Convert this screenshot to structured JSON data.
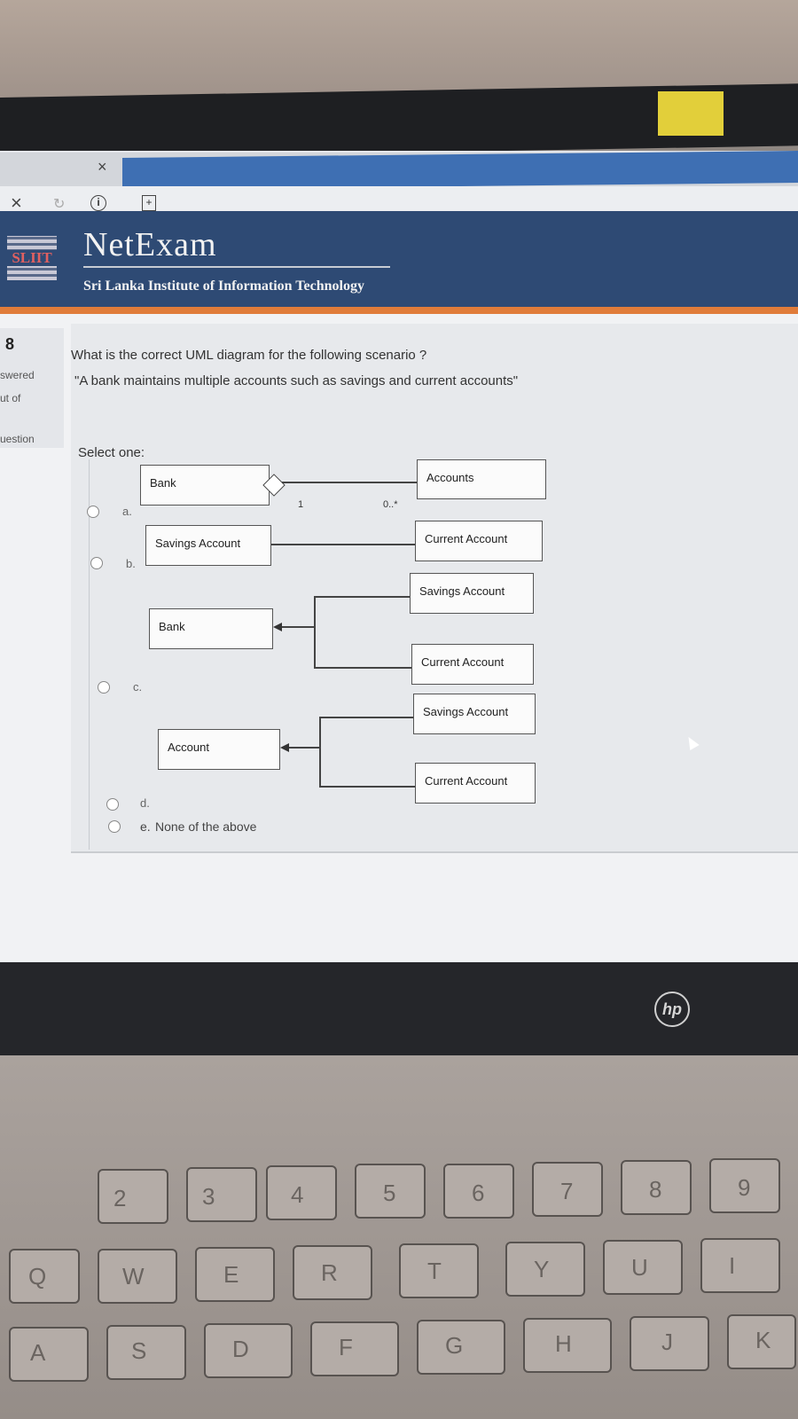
{
  "browser": {
    "tab_close": "×",
    "nav_close": "×"
  },
  "header": {
    "logo_text": "SLIIT",
    "brand": "NetExam",
    "institute": "Sri Lanka Institute of Information Technology"
  },
  "sidebar": {
    "question_number": "8",
    "status_line1": "swered",
    "status_line2": "ut of",
    "flag_label": "uestion"
  },
  "question": {
    "prompt": "What is the correct UML diagram for the following scenario ?",
    "scenario": "\"A bank maintains multiple accounts such as savings and current accounts\"",
    "select_label": "Select one:"
  },
  "options": [
    {
      "letter": "a."
    },
    {
      "letter": "b."
    },
    {
      "letter": "c."
    },
    {
      "letter": "d."
    },
    {
      "letter": "e.",
      "text": "None of the above"
    }
  ],
  "diagram_a": {
    "left": "Bank",
    "right": "Accounts",
    "mult_left": "1",
    "mult_right": "0..*"
  },
  "diagram_b": {
    "left": "Savings Account",
    "right": "Current Account"
  },
  "diagram_c": {
    "parent": "Bank",
    "child1": "Savings Account",
    "child2": "Current Account"
  },
  "diagram_d": {
    "parent": "Account",
    "child1": "Savings Account",
    "child2": "Current Account"
  },
  "laptop": {
    "brand": "hp"
  },
  "keyboard": {
    "row1": [
      "2",
      "3",
      "4",
      "5",
      "6",
      "7",
      "8",
      "9"
    ],
    "row2": [
      "Q",
      "W",
      "E",
      "R",
      "T",
      "Y",
      "U",
      "I"
    ],
    "row3": [
      "A",
      "S",
      "D",
      "F",
      "G",
      "H",
      "J",
      "K"
    ]
  }
}
